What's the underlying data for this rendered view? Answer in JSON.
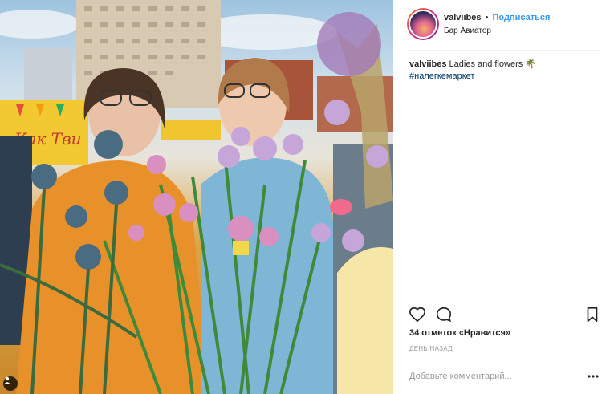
{
  "post": {
    "username": "valviibes",
    "separator": "•",
    "follow_label": "Подписаться",
    "location": "Бар Авиатор",
    "caption_text": "Ladies and flowers 🌴",
    "hashtag": "#налегкемаркет",
    "likes_text": "34 отметок «Нравится»",
    "time_ago": "ДЕНЬ НАЗАД",
    "comment_placeholder": "Добавьте комментарий...",
    "more_label": "•••"
  },
  "photo": {
    "sign_text": "Как Тви",
    "user_tag_icon": "user-icon"
  },
  "icons": {
    "like": "heart-icon",
    "comment": "comment-icon",
    "save": "bookmark-icon",
    "options": "more-options-icon"
  },
  "colors": {
    "follow": "#3897f0",
    "hashtag": "#003569",
    "muted": "#999999"
  }
}
